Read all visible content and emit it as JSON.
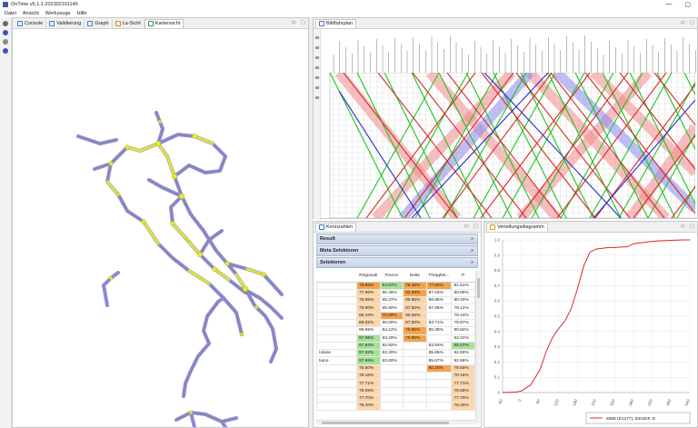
{
  "window": {
    "title": "OnTime v5.1.1.202302101140",
    "min_glyph": "—",
    "max_glyph": "▢"
  },
  "menu": [
    "Datei",
    "Ansicht",
    "Werkzeuge",
    "Hilfe"
  ],
  "left_tabs": [
    {
      "label": "Console",
      "icon": "console-icon"
    },
    {
      "label": "Validierung",
      "icon": "validation-icon"
    },
    {
      "label": "Graph",
      "icon": "graph-icon"
    },
    {
      "label": "La-Sicht",
      "icon": "la-view-icon"
    },
    {
      "label": "Kartensicht",
      "icon": "map-icon",
      "active": true
    }
  ],
  "bild": {
    "tab": "Bildfahrplan",
    "colors": {
      "red": "#d82a2a",
      "green": "#22c422",
      "blue": "#2a2acf",
      "band_red": "#f08a8a",
      "band_blue": "#8a8aee"
    }
  },
  "kenn": {
    "tab": "Kennzahlen",
    "sections": [
      "Result",
      "Meta Selektoren",
      "Selektoren"
    ],
    "columns": [
      "",
      "Regionali",
      "Frecce",
      "Notte",
      "Thraghet...",
      "P"
    ],
    "rows": [
      {
        "name": "",
        "cells": [
          [
            "79.86%",
            "o"
          ],
          [
            "94.87%",
            "g"
          ],
          [
            "78.36%",
            "o"
          ],
          [
            "77.80%",
            "o"
          ],
          [
            "81.61%",
            "w"
          ]
        ]
      },
      {
        "name": "",
        "cells": [
          [
            "77.96%",
            "l"
          ],
          [
            "90.46%",
            "w"
          ],
          [
            "82.98%",
            "o"
          ],
          [
            "87.03%",
            "w"
          ],
          [
            "80.65%",
            "w"
          ]
        ]
      },
      {
        "name": "",
        "cells": [
          [
            "79.96%",
            "l"
          ],
          [
            "85.37%",
            "w"
          ],
          [
            "80.60%",
            "l"
          ],
          [
            "88.95%",
            "w"
          ],
          [
            "80.40%",
            "w"
          ]
        ]
      },
      {
        "name": "",
        "cells": [
          [
            "79.90%",
            "l"
          ],
          [
            "85.90%",
            "w"
          ],
          [
            "87.50%",
            "l"
          ],
          [
            "87.95%",
            "w"
          ],
          [
            "79.12%",
            "w"
          ]
        ]
      },
      {
        "name": "",
        "cells": [
          [
            "86.43%",
            "l"
          ],
          [
            "70.09%",
            "o"
          ],
          [
            "90.66%",
            "l"
          ],
          [
            "",
            "w"
          ],
          [
            "78.44%",
            "w"
          ]
        ]
      },
      {
        "name": "",
        "cells": [
          [
            "88.25%",
            "l"
          ],
          [
            "86.00%",
            "w"
          ],
          [
            "87.50%",
            "l"
          ],
          [
            "83.71%",
            "w"
          ],
          [
            "79.87%",
            "w"
          ]
        ]
      },
      {
        "name": "",
        "cells": [
          [
            "99.65%",
            "w"
          ],
          [
            "94.12%",
            "w"
          ],
          [
            "70.90%",
            "o"
          ],
          [
            "85.38%",
            "w"
          ],
          [
            "90.84%",
            "w"
          ]
        ]
      },
      {
        "name": "",
        "cells": [
          [
            "97.96%",
            "g"
          ],
          [
            "93.29%",
            "w"
          ],
          [
            "70.90%",
            "o"
          ],
          [
            "",
            "w"
          ],
          [
            "93.31%",
            "w"
          ]
        ]
      },
      {
        "name": "",
        "cells": [
          [
            "97.93%",
            "g"
          ],
          [
            "92.92%",
            "w"
          ],
          [
            "",
            "w"
          ],
          [
            "83.93%",
            "w"
          ],
          [
            "95.07%",
            "g"
          ]
        ]
      },
      {
        "name": "Iolane",
        "cells": [
          [
            "97.92%",
            "g"
          ],
          [
            "82.20%",
            "w"
          ],
          [
            "",
            "w"
          ],
          [
            "85.86%",
            "w"
          ],
          [
            "92.60%",
            "w"
          ]
        ]
      },
      {
        "name": "Iiano",
        "cells": [
          [
            "97.98%",
            "g"
          ],
          [
            "82.60%",
            "w"
          ],
          [
            "",
            "w"
          ],
          [
            "85.67%",
            "w"
          ],
          [
            "92.86%",
            "w"
          ]
        ]
      },
      {
        "name": "",
        "cells": [
          [
            "78.50%",
            "l"
          ],
          [
            "",
            "w"
          ],
          [
            "",
            "w"
          ],
          [
            "80.20%",
            "o"
          ],
          [
            "78.50%",
            "l"
          ]
        ]
      },
      {
        "name": "",
        "cells": [
          [
            "78.16%",
            "l"
          ],
          [
            "",
            "w"
          ],
          [
            "",
            "w"
          ],
          [
            "",
            "w"
          ],
          [
            "78.16%",
            "l"
          ]
        ]
      },
      {
        "name": "",
        "cells": [
          [
            "77.71%",
            "l"
          ],
          [
            "",
            "w"
          ],
          [
            "",
            "w"
          ],
          [
            "",
            "w"
          ],
          [
            "77.71%",
            "l"
          ]
        ]
      },
      {
        "name": "",
        "cells": [
          [
            "78.59%",
            "l"
          ],
          [
            "",
            "w"
          ],
          [
            "",
            "w"
          ],
          [
            "",
            "w"
          ],
          [
            "78.59%",
            "l"
          ]
        ]
      },
      {
        "name": "",
        "cells": [
          [
            "77.70%",
            "l"
          ],
          [
            "",
            "w"
          ],
          [
            "",
            "w"
          ],
          [
            "",
            "w"
          ],
          [
            "77.70%",
            "l"
          ]
        ]
      },
      {
        "name": "",
        "cells": [
          [
            "78.40%",
            "l"
          ],
          [
            "",
            "w"
          ],
          [
            "",
            "w"
          ],
          [
            "",
            "w"
          ],
          [
            "78.40%",
            "l"
          ]
        ]
      }
    ]
  },
  "vert": {
    "tab": "Verteilungsdiagramm"
  },
  "chart_data": {
    "type": "line",
    "title": "",
    "ylim": [
      0,
      1.0
    ],
    "yticks": [
      "0",
      "0.1",
      "0.2",
      "0.3",
      "0.4",
      "0.5",
      "0.6",
      "0.7",
      "0.8",
      "0.9",
      "1.0"
    ],
    "xticks": [
      "-60",
      "0",
      "60",
      "120",
      "180",
      "240",
      "300",
      "360",
      "420",
      "480",
      "540"
    ],
    "series": [
      {
        "name": "8358 (E1277), 83GIDF, D",
        "color": "#d82a2a",
        "x": [
          -60,
          -20,
          0,
          30,
          60,
          80,
          100,
          120,
          140,
          160,
          180,
          200,
          220,
          240,
          260,
          280,
          300,
          320,
          340,
          360,
          380,
          400,
          420,
          440,
          460,
          480,
          520,
          540
        ],
        "y": [
          0,
          0.003,
          0.01,
          0.05,
          0.15,
          0.27,
          0.36,
          0.42,
          0.47,
          0.55,
          0.68,
          0.83,
          0.92,
          0.94,
          0.945,
          0.95,
          0.95,
          0.953,
          0.955,
          0.975,
          0.98,
          0.985,
          0.99,
          0.993,
          0.995,
          0.997,
          1.0,
          1.0
        ]
      }
    ],
    "legend_position": "bottom-right"
  }
}
